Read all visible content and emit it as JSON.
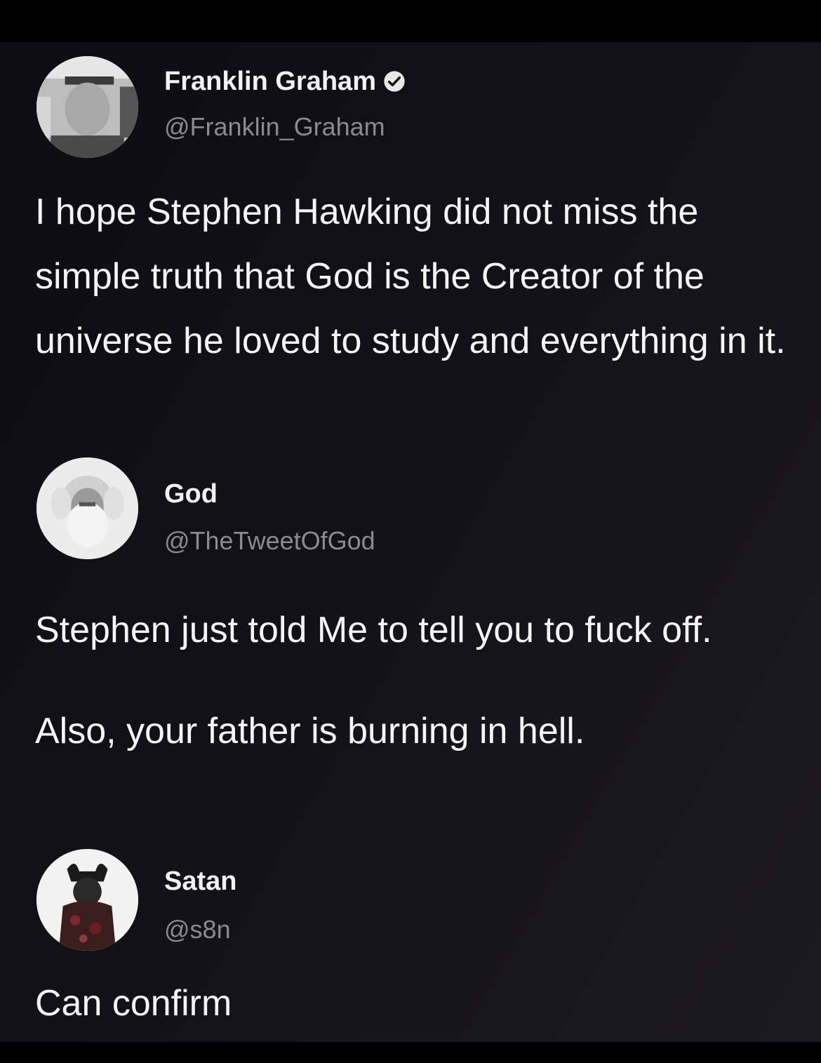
{
  "posts": [
    {
      "display_name": "Franklin Graham",
      "handle": "@Franklin_Graham",
      "verified": true,
      "avatar_icon": "avatar-franklin-graham",
      "text": [
        "I hope Stephen Hawking did not miss the simple truth that God is the Creator of the universe he loved to study and everything in it."
      ]
    },
    {
      "display_name": "God",
      "handle": "@TheTweetOfGod",
      "verified": false,
      "avatar_icon": "avatar-god",
      "text": [
        "Stephen just told Me to tell you to fuck off.",
        "Also, your father is burning in hell."
      ]
    },
    {
      "display_name": "Satan",
      "handle": "@s8n",
      "verified": false,
      "avatar_icon": "avatar-satan",
      "text": [
        "Can confirm"
      ]
    }
  ],
  "colors": {
    "background": "#121118",
    "name": "#f2f2f2",
    "handle": "#8a8a8f",
    "text": "#f5f5f5",
    "verified_badge": "#e8e8e8"
  }
}
